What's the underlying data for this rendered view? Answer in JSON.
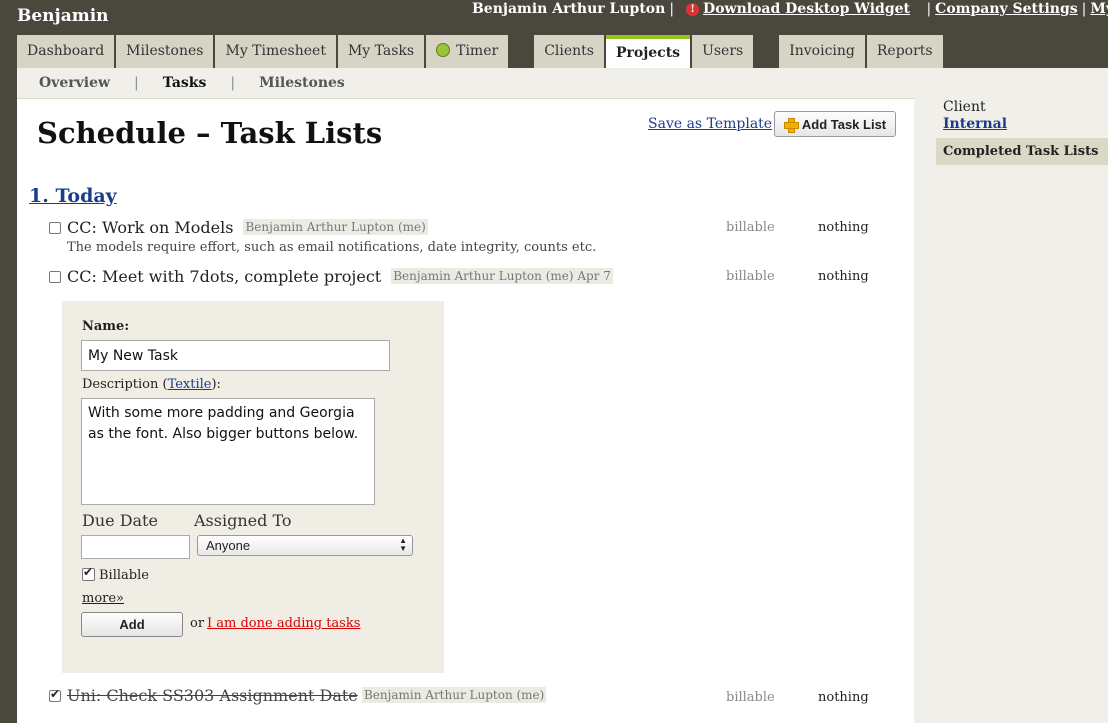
{
  "app": {
    "brand": "Benjamin"
  },
  "userbar": {
    "user_name": "Benjamin Arthur Lupton",
    "download_widget": "Download Desktop Widget",
    "company_settings": "Company Settings",
    "my": "My"
  },
  "tabs": [
    {
      "label": "Dashboard"
    },
    {
      "label": "Milestones"
    },
    {
      "label": "My Timesheet"
    },
    {
      "label": "My Tasks"
    },
    {
      "label": "Timer"
    },
    {
      "label": "Clients"
    },
    {
      "label": "Projects",
      "active": true
    },
    {
      "label": "Users"
    },
    {
      "label": "Invoicing"
    },
    {
      "label": "Reports"
    }
  ],
  "subnav": {
    "overview": "Overview",
    "tasks": "Tasks",
    "milestones": "Milestones",
    "active": "Tasks"
  },
  "page": {
    "title": "Schedule – Task Lists",
    "save_template": "Save as Template",
    "add_task_list": "Add Task List"
  },
  "task_list": {
    "heading": "1. Today",
    "tasks": [
      {
        "name": "CC: Work on Models",
        "assignee": "Benjamin Arthur Lupton (me)",
        "description": "The models require effort, such as email notifications, date integrity, counts etc.",
        "billable": "billable",
        "hours": "nothing",
        "checked": false
      },
      {
        "name": "CC: Meet with 7dots, complete project",
        "assignee": "Benjamin Arthur Lupton (me) Apr 7",
        "billable": "billable",
        "hours": "nothing",
        "checked": false
      },
      {
        "name": "Uni: Check SS303 Assignment Date",
        "assignee": "Benjamin Arthur Lupton (me)",
        "billable": "billable",
        "hours": "nothing",
        "checked": true
      }
    ]
  },
  "form": {
    "name_label": "Name:",
    "name_value": "My New Task",
    "description_label_prefix": "Description (",
    "textile_link": "Textile",
    "description_label_suffix": "):",
    "description_value": "With some more padding and Georgia as the font. Also bigger buttons below.",
    "due_date_label": "Due Date",
    "due_date_value": "",
    "assigned_to_label": "Assigned To",
    "assigned_to_value": "Anyone",
    "billable_label": "Billable",
    "billable_checked": true,
    "more_link": "more»",
    "add_button": "Add",
    "or_text": "or",
    "done_link": "I am done adding tasks"
  },
  "sidebar": {
    "client_label": "Client",
    "client_value": "Internal",
    "completed_lists": "Completed Task Lists"
  },
  "colors": {
    "accent": "#93c41f",
    "header_bg": "#4a473c",
    "link": "#1b3c8c",
    "form_bg": "#f0eee4"
  }
}
